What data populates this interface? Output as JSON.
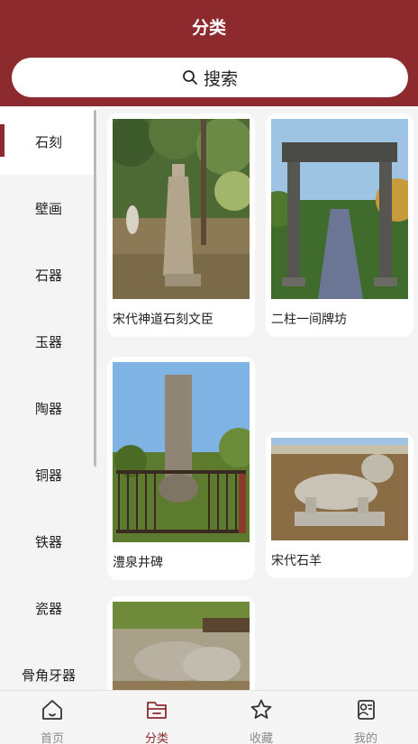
{
  "header": {
    "title": "分类"
  },
  "search": {
    "label": "搜索"
  },
  "sidebar": {
    "items": [
      {
        "label": "石刻"
      },
      {
        "label": "壁画"
      },
      {
        "label": "石器"
      },
      {
        "label": "玉器"
      },
      {
        "label": "陶器"
      },
      {
        "label": "铜器"
      },
      {
        "label": "铁器"
      },
      {
        "label": "瓷器"
      },
      {
        "label": "骨角牙器"
      }
    ]
  },
  "items": [
    {
      "label": "宋代神道石刻文臣"
    },
    {
      "label": "二柱一间牌坊"
    },
    {
      "label": "澧泉井碑"
    },
    {
      "label": "宋代石羊"
    },
    {
      "label": ""
    }
  ],
  "tabbar": {
    "tabs": [
      {
        "label": "首页",
        "icon": "home-icon"
      },
      {
        "label": "分类",
        "icon": "folder-icon"
      },
      {
        "label": "收藏",
        "icon": "star-icon"
      },
      {
        "label": "我的",
        "icon": "profile-icon"
      }
    ]
  },
  "colors": {
    "brand": "#8c2a2e",
    "inactive": "#8a8a8a"
  }
}
